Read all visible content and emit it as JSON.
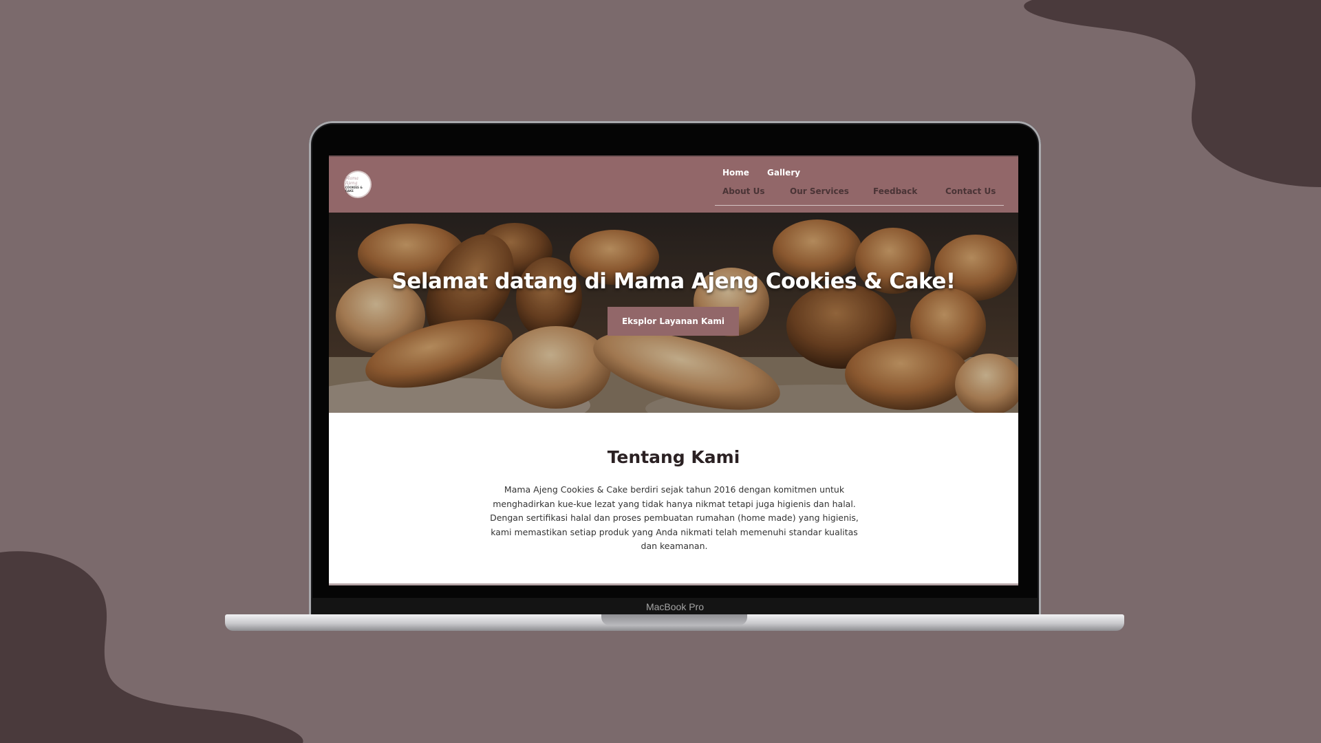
{
  "device": {
    "label": "MacBook Pro"
  },
  "navbar": {
    "logo_text_top": "Mama Ajeng",
    "logo_text_bottom": "COOKIES & CAKE",
    "links": {
      "home": "Home",
      "gallery": "Gallery",
      "about_us": "About Us",
      "our_services": "Our Services",
      "feedback": "Feedback",
      "contact_us": "Contact Us"
    }
  },
  "hero": {
    "title": "Selamat datang di Mama Ajeng Cookies & Cake!",
    "button_label": "Eksplor Layanan Kami"
  },
  "about": {
    "title": "Tentang Kami",
    "lines": [
      "Mama Ajeng Cookies & Cake berdiri sejak tahun 2016 dengan komitmen untuk",
      "menghadirkan kue-kue lezat yang tidak hanya nikmat tetapi juga higienis dan halal.",
      "Dengan sertifikasi halal dan proses pembuatan rumahan (home made) yang higienis,",
      "kami memastikan setiap produk yang Anda nikmati telah memenuhi standar kualitas",
      "dan keamanan."
    ]
  },
  "colors": {
    "background": "#7b6a6c",
    "blob": "#4a3a3c",
    "navbar": "#926769",
    "accent_button": "#926769",
    "nav_text_dark": "#4a3436"
  }
}
